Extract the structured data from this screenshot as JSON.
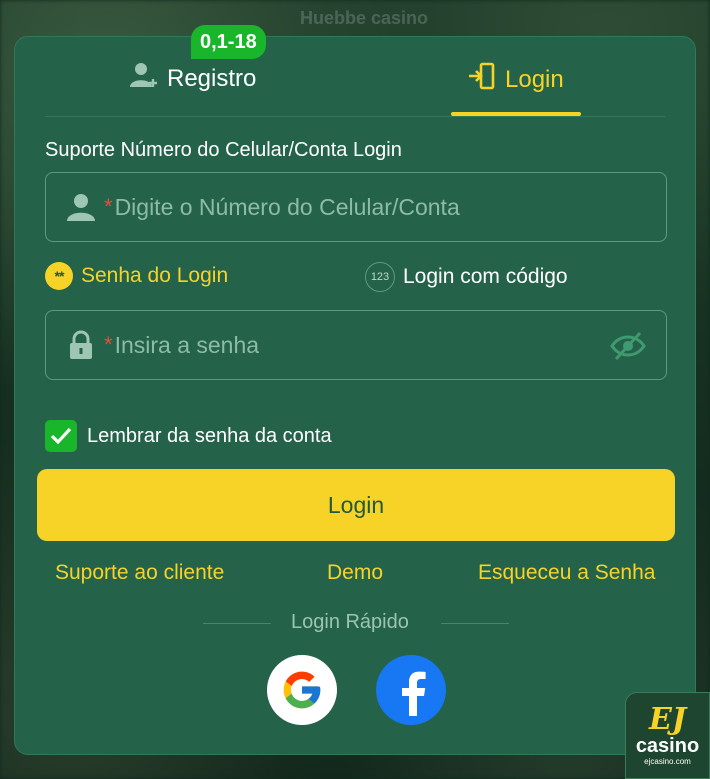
{
  "background": {
    "blurred_text": "Huebbe casino"
  },
  "tabs": {
    "register_label": "Registro",
    "register_badge": "0,1-18",
    "login_label": "Login"
  },
  "form": {
    "section_label": "Suporte Número do Celular/Conta Login",
    "account_required_mark": "*",
    "account_placeholder": "Digite o Número do Celular/Conta",
    "mode_password_label": "Senha do Login",
    "mode_password_icon_text": "**",
    "mode_code_label": "Login com código",
    "mode_code_icon_text": "123",
    "password_required_mark": "*",
    "password_placeholder": "Insira a senha",
    "remember_label": "Lembrar da senha da conta",
    "remember_checked": true,
    "login_button": "Login"
  },
  "links": {
    "support": "Suporte ao cliente",
    "demo": "Demo",
    "forgot": "Esqueceu a Senha"
  },
  "quick_login": {
    "label": "Login Rápido",
    "providers": [
      "google-icon",
      "facebook-icon"
    ]
  },
  "brand": {
    "logo_letters": "EJ",
    "logo_word": "casino",
    "logo_url": "ejcasino.com"
  },
  "colors": {
    "card": "#24634a",
    "accent": "#f7d327",
    "badge": "#19b52b"
  }
}
